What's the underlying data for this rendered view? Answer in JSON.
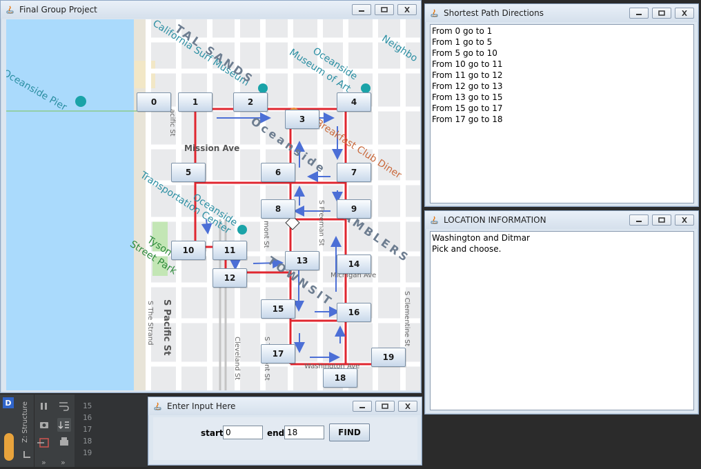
{
  "map_window": {
    "title": "Final Group Project",
    "nodes": [
      "0",
      "1",
      "2",
      "3",
      "4",
      "5",
      "6",
      "7",
      "8",
      "9",
      "10",
      "11",
      "12",
      "13",
      "14",
      "15",
      "16",
      "17",
      "18",
      "19"
    ],
    "map_labels": {
      "oceanside_pier": "Oceanside Pier",
      "california_surf_museum": "California Surf Museum",
      "oceanside_museum_of_art_1": "Oceanside",
      "oceanside_museum_of_art_2": "Museum of Art",
      "mission_ave": "Mission Ave",
      "breakfast_club_diner": "Breakfast Club Diner",
      "transportation_center_1": "Oceanside",
      "transportation_center_2": "Transportation Center",
      "tyson_street_park_1": "Tyson",
      "tyson_street_park_2": "Street Park",
      "s_pacific_st": "S Pacific St",
      "s_the_strand": "S The Strand",
      "cleveland_st": "Cleveland St",
      "michigan_ave": "Michigan Ave",
      "s_clementine_st": "S Clementine St",
      "washington_ave": "Washington Ave",
      "s_freeman_st": "S Freeman St",
      "s_tremont_st_1": "mont St",
      "s_tremont_st_2": "S Tremont St",
      "s_pacific_st_small": "acific St",
      "neighborhood": "Neighbo",
      "tal_sands": "TAL SANDS",
      "oceanside_big": "Oceanside",
      "amblers": "AMBLERS",
      "townsite": "TOWNSIT"
    }
  },
  "directions_window": {
    "title": "Shortest Path Directions",
    "lines": [
      "From 0 go to 1",
      "From 1 go to 5",
      "From 5 go to 10",
      "From 10 go to 11",
      "From 11 go to 12",
      "From 12 go to 13",
      "From 13 go to 15",
      "From 15 go to 17",
      "From 17 go to 18"
    ]
  },
  "location_window": {
    "title": "LOCATION INFORMATION",
    "lines": [
      "Washington and Ditmar",
      "Pick and choose."
    ]
  },
  "input_window": {
    "title": "Enter Input Here",
    "start_label": "start",
    "start_value": "0",
    "end_label": "end",
    "end_value": "18",
    "find_label": "FIND"
  },
  "ide": {
    "structure_label": "Z: Structure",
    "line_numbers": [
      "15",
      "16",
      "17",
      "18",
      "19"
    ],
    "more_1": "»",
    "more_2": "»"
  },
  "colors": {
    "route_red": "#e0262f",
    "arrow_blue": "#4c6fd6",
    "water": "#aadafc",
    "road": "#ffffff"
  }
}
